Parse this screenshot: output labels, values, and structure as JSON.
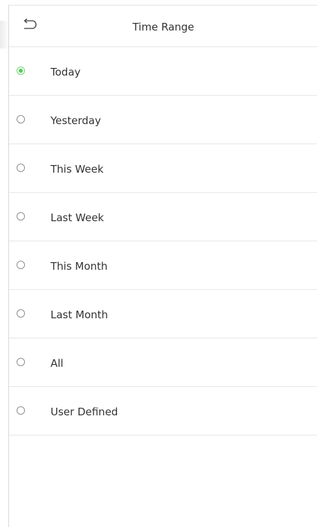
{
  "header": {
    "title": "Time Range",
    "back_icon": "back-arrow-icon"
  },
  "time_range": {
    "selected": "Today",
    "options": [
      {
        "label": "Today",
        "checked": true
      },
      {
        "label": "Yesterday",
        "checked": false
      },
      {
        "label": "This Week",
        "checked": false
      },
      {
        "label": "Last Week",
        "checked": false
      },
      {
        "label": "This Month",
        "checked": false
      },
      {
        "label": "Last Month",
        "checked": false
      },
      {
        "label": "All",
        "checked": false
      },
      {
        "label": "User Defined",
        "checked": false
      }
    ]
  },
  "colors": {
    "selected_radio": "#5bc85b",
    "unselected_radio_border": "#8c8c8c",
    "divider": "#e6e6e6",
    "text": "#333333"
  }
}
